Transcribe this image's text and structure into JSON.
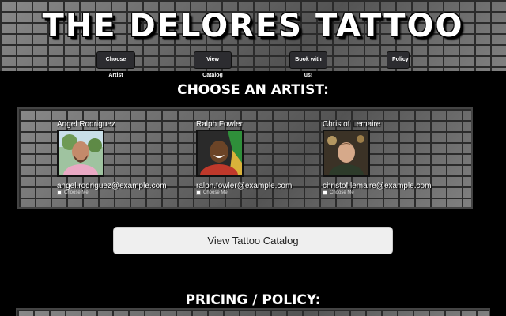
{
  "site": {
    "title": "THE DELORES TATTOO"
  },
  "nav": [
    {
      "label": "Choose Artist"
    },
    {
      "label": "View Catalog"
    },
    {
      "label": "Book with us!"
    },
    {
      "label": "Policy"
    }
  ],
  "choose_heading": "CHOOSE AN ARTIST:",
  "artists": [
    {
      "name": "Angel Rodriguez",
      "email": "angel.rodriguez@example.com",
      "choose_label": "Choose Me"
    },
    {
      "name": "Ralph Fowler",
      "email": "ralph.fowler@example.com",
      "choose_label": "Choose Me"
    },
    {
      "name": "Christof Lemaire",
      "email": "christof.lemaire@example.com",
      "choose_label": "Choose Me"
    }
  ],
  "catalog_button": "View Tattoo Catalog",
  "policy_heading": "PRICING / POLICY:"
}
